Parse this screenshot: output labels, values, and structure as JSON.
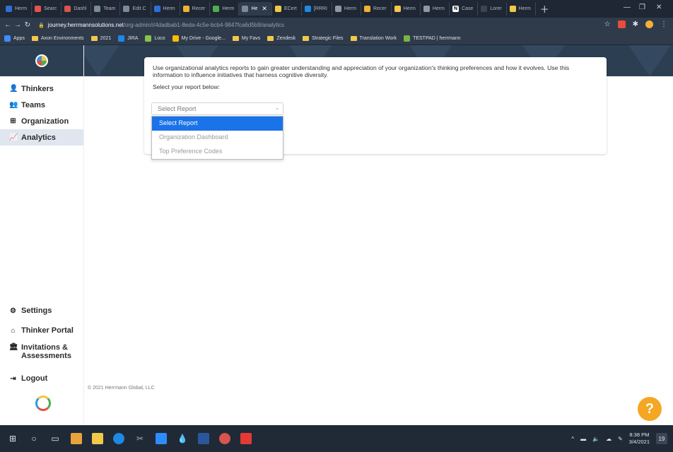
{
  "browser": {
    "tabs": [
      {
        "label": "Herm",
        "color": "#2f6fd6"
      },
      {
        "label": "Searc",
        "color": "#e5534b"
      },
      {
        "label": "Dashl",
        "color": "#d9534f"
      },
      {
        "label": "Team",
        "color": "#7a8a9a"
      },
      {
        "label": "Edit C",
        "color": "#7a8a9a"
      },
      {
        "label": "Herm",
        "color": "#2f6fd6"
      },
      {
        "label": "Recer",
        "color": "#f2b134"
      },
      {
        "label": "Herm",
        "color": "#4caf50"
      },
      {
        "label": "He",
        "color": "#7a8a9a",
        "active": true
      },
      {
        "label": "ECert",
        "color": "#f2c84b"
      },
      {
        "label": "[RRRI",
        "color": "#1e88e5"
      },
      {
        "label": "Herm",
        "color": "#8e99a6"
      },
      {
        "label": "Recer",
        "color": "#f2b134"
      },
      {
        "label": "Herm",
        "color": "#f2c84b"
      },
      {
        "label": "Herm",
        "color": "#8e99a6"
      },
      {
        "label": "Case",
        "color": "#ffffff",
        "glyph": "N"
      },
      {
        "label": "Lorer",
        "color": "#3a4656"
      },
      {
        "label": "Herm",
        "color": "#f2c84b"
      }
    ],
    "url_host": "journey.herrmannsolutions.net",
    "url_path": "/org-admin/i/4dadbab1-8eda-4c5e-bcb4-9847fca6d5b9/analytics",
    "bookmarks": [
      {
        "label": "Apps",
        "type": "apps"
      },
      {
        "label": "Axon Environments",
        "type": "folder"
      },
      {
        "label": "2021",
        "type": "folder"
      },
      {
        "label": "JIRA",
        "type": "jira"
      },
      {
        "label": "Loco",
        "type": "loco"
      },
      {
        "label": "My Drive - Google...",
        "type": "drive"
      },
      {
        "label": "My Favs",
        "type": "folder"
      },
      {
        "label": "Zendesk",
        "type": "folder"
      },
      {
        "label": "Strategic Files",
        "type": "folder"
      },
      {
        "label": "Translation Work",
        "type": "folder"
      },
      {
        "label": "TESTPAD | herrmann",
        "type": "testpad"
      }
    ]
  },
  "sidebar": {
    "top_items": [
      {
        "label": "Thinkers",
        "icon": "user-group-icon",
        "glyph": "👤"
      },
      {
        "label": "Teams",
        "icon": "users-icon",
        "glyph": "👥"
      },
      {
        "label": "Organization",
        "icon": "sitemap-icon",
        "glyph": "⊞"
      },
      {
        "label": "Analytics",
        "icon": "chart-line-icon",
        "glyph": "📈",
        "active": true
      }
    ],
    "bottom_items": [
      {
        "label": "Settings",
        "icon": "gear-icon",
        "glyph": "⚙"
      },
      {
        "label": "Thinker Portal",
        "icon": "home-icon",
        "glyph": "⌂"
      },
      {
        "label": "Invitations & Assessments",
        "icon": "bank-icon",
        "glyph": "🏛"
      },
      {
        "label": "Logout",
        "icon": "logout-icon",
        "glyph": "⇥"
      }
    ]
  },
  "main": {
    "intro": "Use organizational analytics reports to gain greater understanding and appreciation of your organization's thinking preferences and how it evolves. Use this information to influence initiatives that harness cognitive diversity.",
    "select_label": "Select your report below:",
    "select_value": "Select Report",
    "options": [
      "Select Report",
      "Organization Dashboard",
      "Top Preference Codes"
    ],
    "footer": "© 2021 Herrmann Global, LLC",
    "help": "?"
  },
  "taskbar": {
    "time": "8:38 PM",
    "date": "3/4/2021",
    "notification_count": "19"
  },
  "colors": {
    "brand_dark": "#2c3e52",
    "active_nav": "#dfe6ef",
    "selected_option": "#1a73e8",
    "help": "#f5a623"
  }
}
